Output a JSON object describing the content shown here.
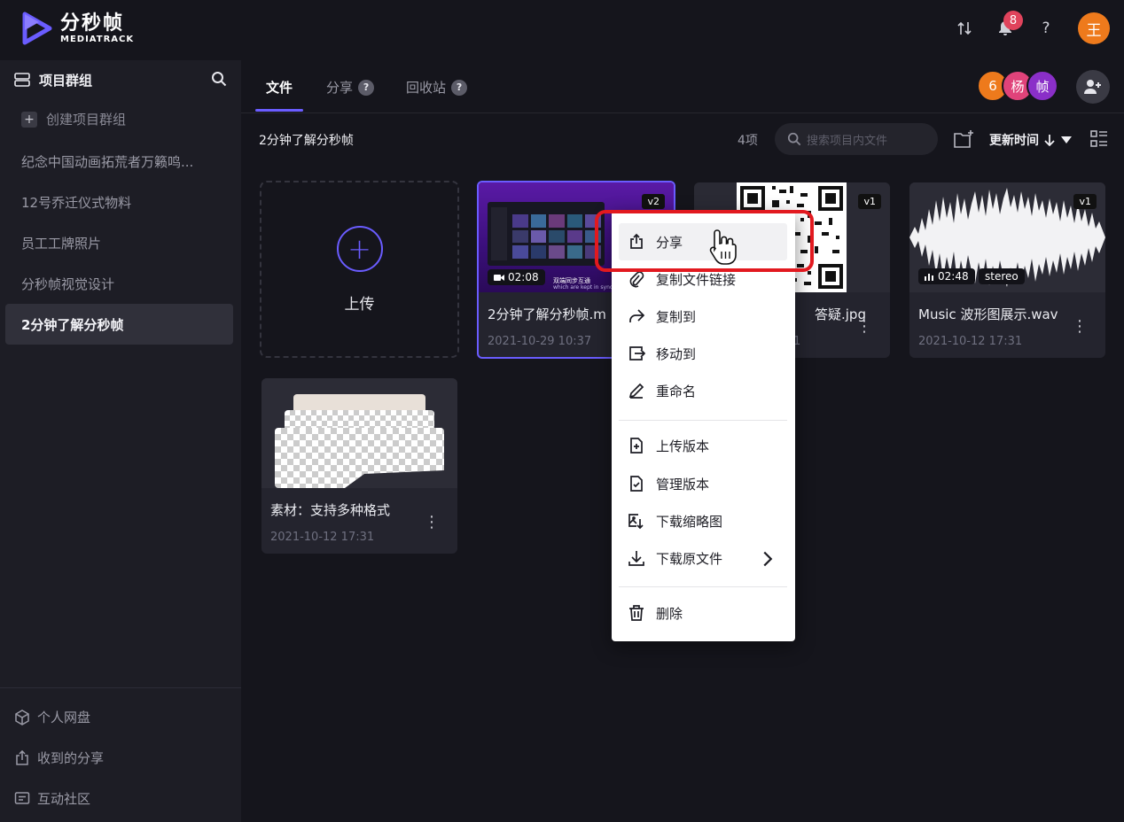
{
  "app": {
    "logo_cn": "分秒帧",
    "logo_en": "MEDIATRACK",
    "brand_color": "#6a5cff"
  },
  "topbar": {
    "notification_count": "8",
    "help_label": "?",
    "user_initial": "王"
  },
  "sidebar": {
    "header_label": "项目群组",
    "create_label": "创建项目群组",
    "groups": [
      {
        "label": "纪念中国动画拓荒者万籁鸣..."
      },
      {
        "label": "12号乔迁仪式物料"
      },
      {
        "label": "员工工牌照片"
      },
      {
        "label": "分秒帧视觉设计"
      },
      {
        "label": "2分钟了解分秒帧",
        "active": true
      }
    ],
    "bottom": [
      {
        "label": "个人网盘",
        "icon": "cube-icon"
      },
      {
        "label": "收到的分享",
        "icon": "share-icon"
      },
      {
        "label": "互动社区",
        "icon": "chat-icon"
      }
    ]
  },
  "tabs": [
    {
      "label": "文件",
      "active": true
    },
    {
      "label": "分享",
      "help": "?"
    },
    {
      "label": "回收站",
      "help": "?"
    }
  ],
  "members": [
    {
      "initial": "6",
      "color": "#ee7a1c"
    },
    {
      "initial": "杨",
      "color": "#e0437a"
    },
    {
      "initial": "帧",
      "color": "#8a2fc8"
    }
  ],
  "toolbar": {
    "breadcrumb": "2分钟了解分秒帧",
    "item_count": "4项",
    "search_placeholder": "搜索项目内文件",
    "sort_label": "更新时间"
  },
  "upload": {
    "label": "上传"
  },
  "files": [
    {
      "name": "2分钟了解分秒帧.m",
      "date": "2021-10-29 10:37",
      "version": "v2",
      "duration": "02:08",
      "thumb_caption": "双端同步互通",
      "thumb_sub": "which are kept in sync.",
      "selected": true
    },
    {
      "name": "答疑.jpg",
      "date": "1",
      "version": "v1"
    },
    {
      "name": "Music 波形图展示.wav",
      "date": "2021-10-12 17:31",
      "version": "v1",
      "duration": "02:48",
      "tag": "stereo"
    },
    {
      "name": "素材：支持多种格式",
      "date": "2021-10-12 17:31"
    }
  ],
  "menu": {
    "items": [
      {
        "label": "分享",
        "icon": "share-icon"
      },
      {
        "label": "复制文件链接",
        "icon": "link-icon"
      },
      {
        "label": "复制到",
        "icon": "forward-icon"
      },
      {
        "label": "移动到",
        "icon": "move-icon"
      },
      {
        "label": "重命名",
        "icon": "pencil-icon"
      },
      {
        "label": "上传版本",
        "icon": "file-plus-icon"
      },
      {
        "label": "管理版本",
        "icon": "file-check-icon"
      },
      {
        "label": "下载缩略图",
        "icon": "image-download-icon"
      },
      {
        "label": "下载原文件",
        "icon": "download-icon"
      },
      {
        "label": "删除",
        "icon": "trash-icon"
      }
    ]
  }
}
